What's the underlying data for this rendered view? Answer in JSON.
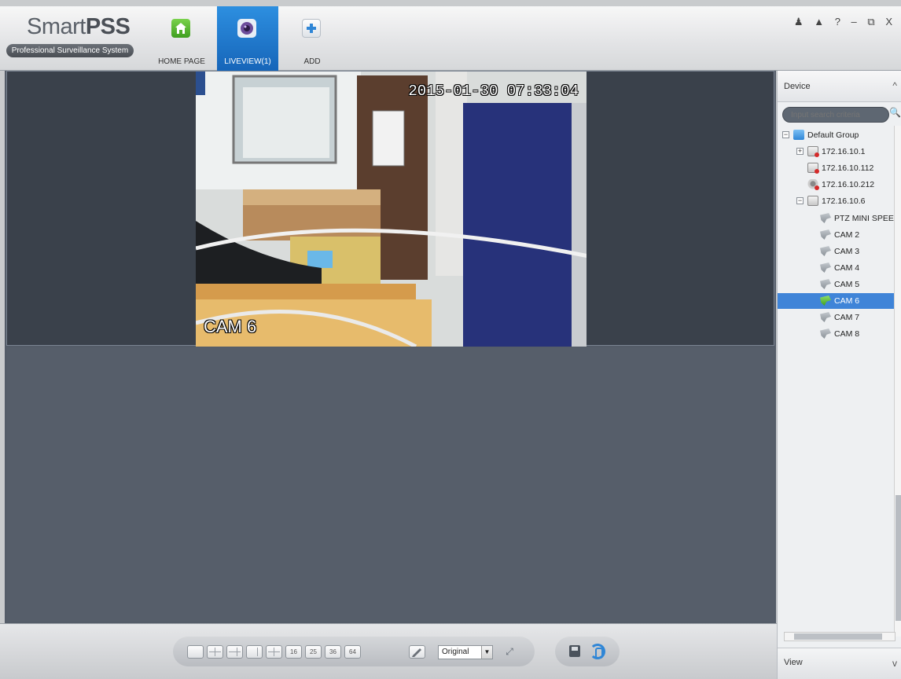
{
  "app": {
    "logo_title_light": "Smart",
    "logo_title_bold": "PSS",
    "logo_subtitle": "Professional Surveillance System"
  },
  "nav": {
    "tabs": [
      {
        "label": "HOME PAGE",
        "icon": "home-icon",
        "active": false
      },
      {
        "label": "LIVEVIEW(1)",
        "icon": "camera-icon",
        "active": true
      },
      {
        "label": "ADD",
        "icon": "plus-icon",
        "active": false
      }
    ]
  },
  "window_controls": {
    "user": "♟",
    "lock": "▲",
    "help": "?",
    "minimize": "–",
    "restore": "⧉",
    "close": "X"
  },
  "video": {
    "timestamp": "2015-01-30 07:33:04",
    "camera_label": "CAM 6"
  },
  "device_panel": {
    "header": "Device",
    "collapse_icon": "^",
    "search_placeholder": "Input search criteria",
    "search_icon": "🔍",
    "tree": [
      {
        "label": "Default Group",
        "icon": "folder-icon",
        "toggle": "−",
        "level": 0
      },
      {
        "label": "172.16.10.1",
        "icon": "dvr-offline-icon",
        "toggle": "+",
        "level": 1
      },
      {
        "label": "172.16.10.112",
        "icon": "dvr-offline-icon",
        "toggle": "",
        "level": 1
      },
      {
        "label": "172.16.10.212",
        "icon": "ipc-offline-icon",
        "toggle": "",
        "level": 1
      },
      {
        "label": "172.16.10.6",
        "icon": "dvr-icon",
        "toggle": "−",
        "level": 1
      },
      {
        "label": "PTZ MINI SPEE",
        "icon": "camera-icon",
        "toggle": "",
        "level": 2
      },
      {
        "label": "CAM 2",
        "icon": "camera-icon",
        "toggle": "",
        "level": 2
      },
      {
        "label": "CAM 3",
        "icon": "camera-icon",
        "toggle": "",
        "level": 2
      },
      {
        "label": "CAM 4",
        "icon": "camera-icon",
        "toggle": "",
        "level": 2
      },
      {
        "label": "CAM 5",
        "icon": "camera-icon",
        "toggle": "",
        "level": 2
      },
      {
        "label": "CAM 6",
        "icon": "camera-live-icon",
        "toggle": "",
        "level": 2,
        "selected": true
      },
      {
        "label": "CAM 7",
        "icon": "camera-icon",
        "toggle": "",
        "level": 2
      },
      {
        "label": "CAM 8",
        "icon": "camera-icon",
        "toggle": "",
        "level": 2
      }
    ]
  },
  "view_panel": {
    "header": "View",
    "expand_icon": "v"
  },
  "toolbar": {
    "layouts": [
      "1",
      "4",
      "6",
      "8",
      "9",
      "16",
      "25",
      "36",
      "64"
    ],
    "custom_layout_icon": "pencil-icon",
    "stream_select": "Original",
    "fullscreen_icon": "fullscreen-icon",
    "save_icon": "save-icon",
    "refresh_icon": "refresh-icon"
  },
  "colors": {
    "active_tab": "#1f78cf",
    "selected_row": "#3f84d8",
    "video_bg": "#545c68"
  }
}
